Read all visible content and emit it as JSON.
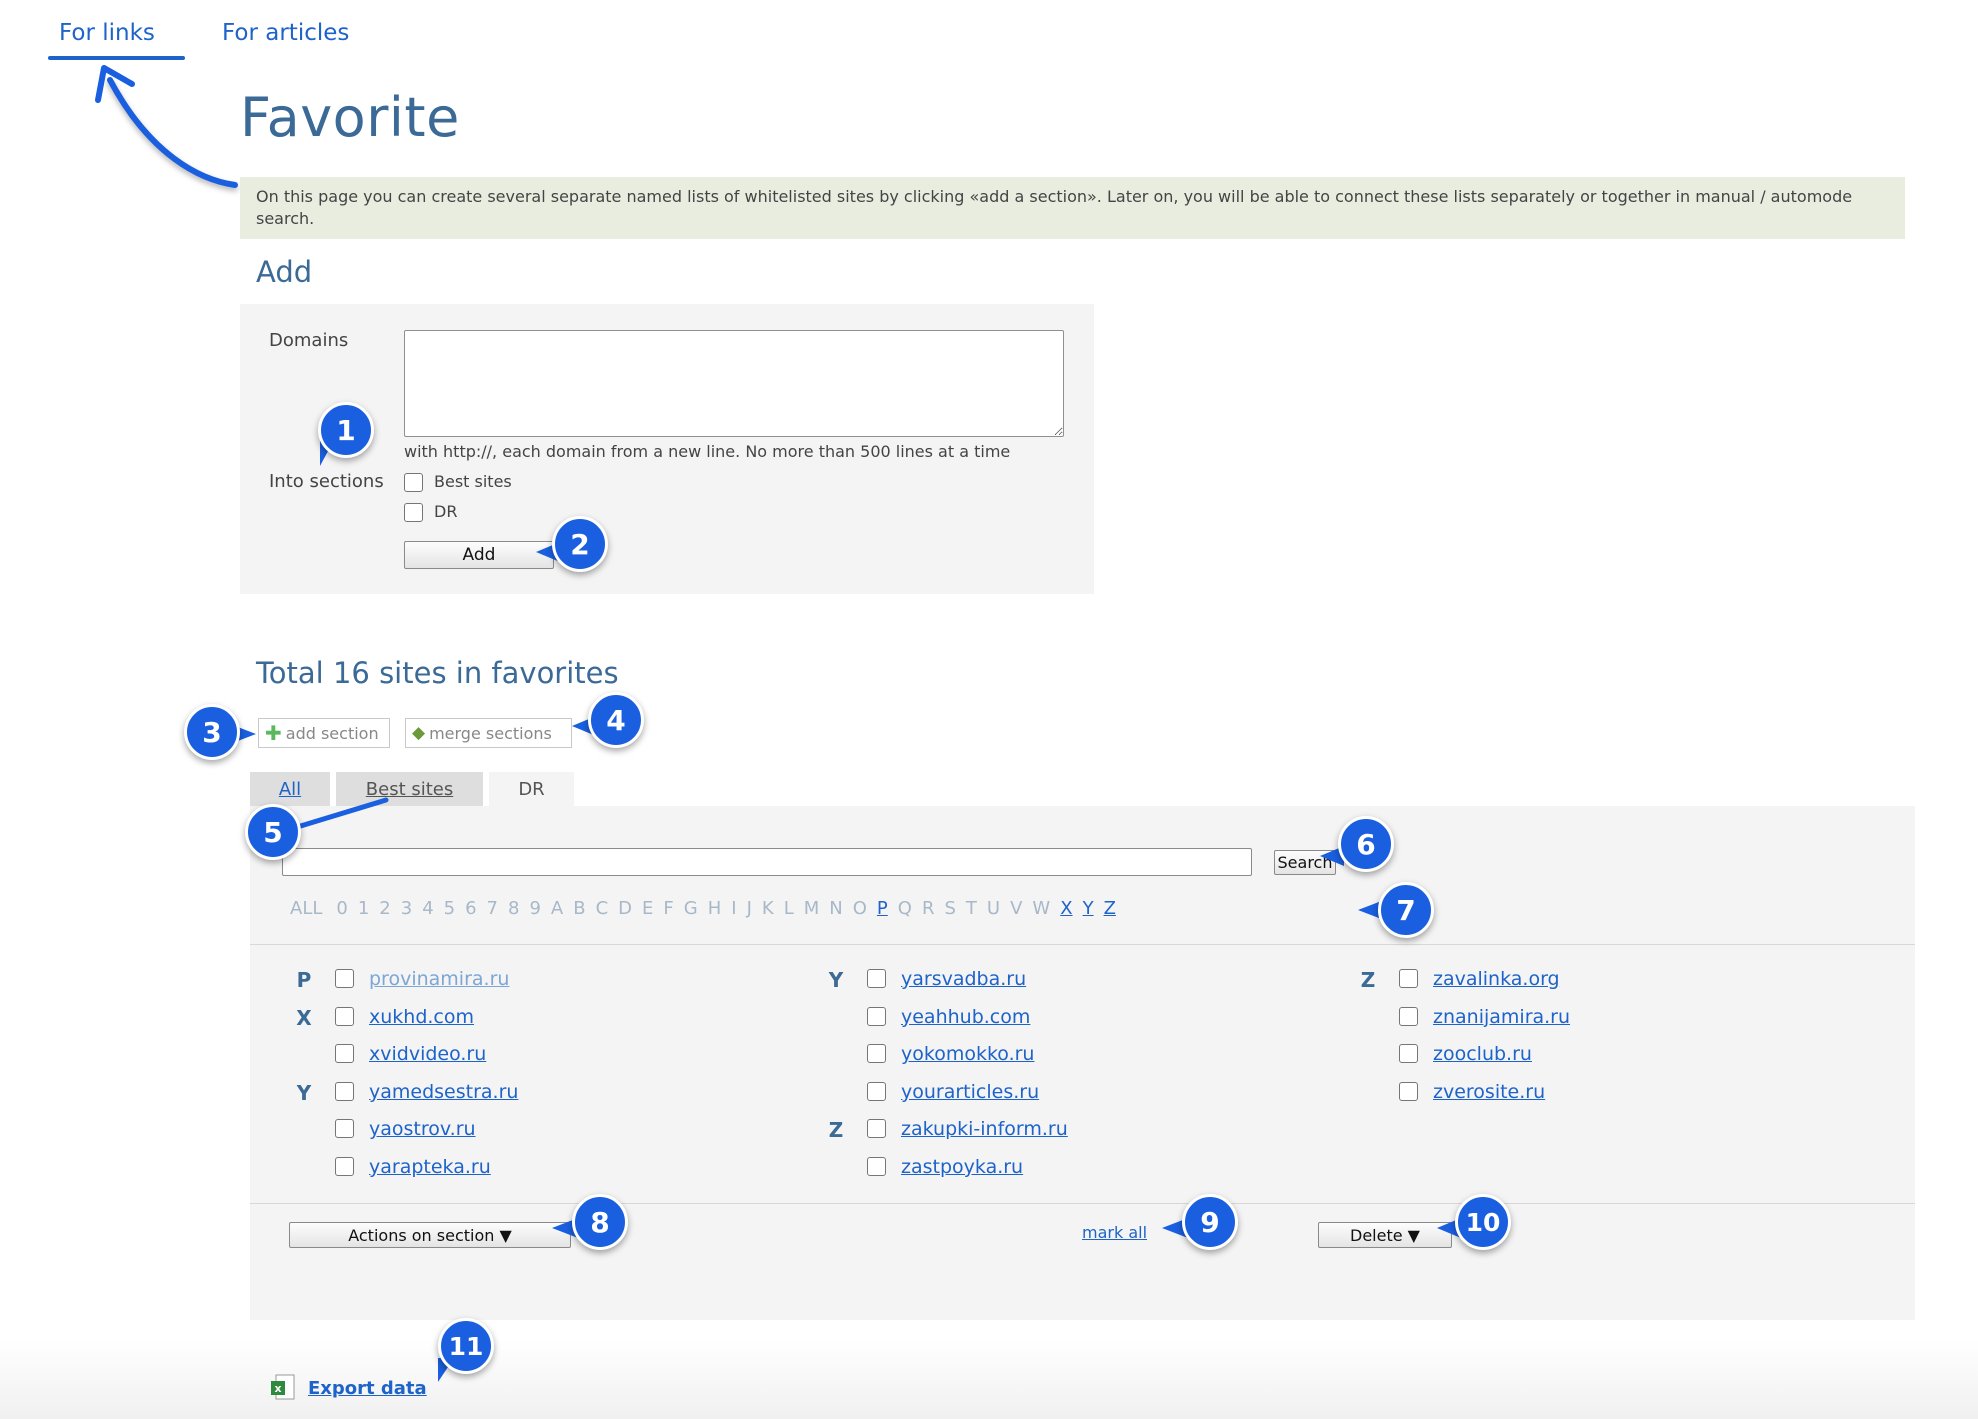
{
  "top_tabs": {
    "links": "For links",
    "articles": "For articles"
  },
  "page": {
    "title": "Favorite",
    "info": "On this page you can create several separate named lists of whitelisted sites by clicking «add a section». Later on, you will be able to connect these lists separately or together in manual / automode search."
  },
  "add_form": {
    "heading": "Add",
    "domains_label": "Domains",
    "domains_value": "",
    "hint": "with http://, each domain from a new line. No more than 500 lines at a time",
    "sections_label": "Into sections",
    "section_options": [
      "Best sites",
      "DR"
    ],
    "submit_label": "Add"
  },
  "favorites": {
    "heading": "Total 16 sites in favorites",
    "add_section_label": "add section",
    "merge_sections_label": "merge sections",
    "tabs": [
      "All",
      "Best sites",
      "DR"
    ],
    "active_tab": "DR",
    "search_value": "",
    "search_label": "Search",
    "alphabet": [
      "ALL",
      "0",
      "1",
      "2",
      "3",
      "4",
      "5",
      "6",
      "7",
      "8",
      "9",
      "A",
      "B",
      "C",
      "D",
      "E",
      "F",
      "G",
      "H",
      "I",
      "J",
      "K",
      "L",
      "M",
      "N",
      "O",
      "P",
      "Q",
      "R",
      "S",
      "T",
      "U",
      "V",
      "W",
      "X",
      "Y",
      "Z"
    ],
    "active_letters": [
      "P",
      "X",
      "Y",
      "Z"
    ],
    "columns": [
      [
        {
          "letter": "P",
          "site": "provinamira.ru",
          "visited": true
        },
        {
          "letter": "X",
          "site": "xukhd.com",
          "visited": false
        },
        {
          "letter": "",
          "site": "xvidvideo.ru",
          "visited": false
        },
        {
          "letter": "Y",
          "site": "yamedsestra.ru",
          "visited": false
        },
        {
          "letter": "",
          "site": "yaostrov.ru",
          "visited": false
        },
        {
          "letter": "",
          "site": "yarapteka.ru",
          "visited": false
        }
      ],
      [
        {
          "letter": "Y",
          "site": "yarsvadba.ru",
          "visited": false
        },
        {
          "letter": "",
          "site": "yeahhub.com",
          "visited": false
        },
        {
          "letter": "",
          "site": "yokomokko.ru",
          "visited": false
        },
        {
          "letter": "",
          "site": "yourarticles.ru",
          "visited": false
        },
        {
          "letter": "Z",
          "site": "zakupki-inform.ru",
          "visited": false
        },
        {
          "letter": "",
          "site": "zastpoyka.ru",
          "visited": false
        }
      ],
      [
        {
          "letter": "Z",
          "site": "zavalinka.org",
          "visited": false
        },
        {
          "letter": "",
          "site": "znanijamira.ru",
          "visited": false
        },
        {
          "letter": "",
          "site": "zooclub.ru",
          "visited": false
        },
        {
          "letter": "",
          "site": "zverosite.ru",
          "visited": false
        }
      ]
    ],
    "actions_label": "Actions on section ▼",
    "mark_all_label": "mark all",
    "delete_label": "Delete ▼",
    "export_label": "Export data"
  },
  "callouts": [
    "1",
    "2",
    "3",
    "4",
    "5",
    "6",
    "7",
    "8",
    "9",
    "10",
    "11"
  ],
  "colors": {
    "accent": "#1d63c9",
    "heading": "#3b6a97",
    "callout": "#1a5fe0",
    "info_bg": "#e9ede0",
    "panel_bg": "#f4f4f4"
  }
}
